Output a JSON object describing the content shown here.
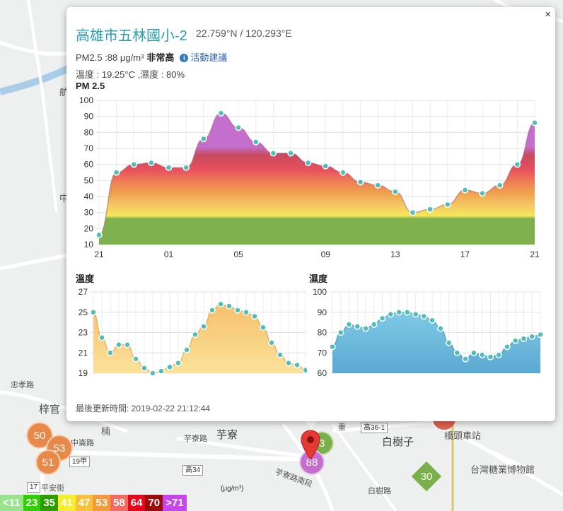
{
  "popup": {
    "station_name": "高雄市五林國小-2",
    "coords": "22.759°N / 120.293°E",
    "pm_line": "PM2.5 :88 μg/m³",
    "pm_level": "非常高",
    "info_icon": "i",
    "advice_link": "活動建議",
    "weather": "溫度 : 19.25°C ,濕度 : 80%",
    "pm_chart_title": "PM 2.5",
    "temp_chart_title": "溫度",
    "hum_chart_title": "濕度",
    "updated": "最後更新時間: 2019-02-22 21:12:44",
    "close": "×"
  },
  "map": {
    "labels": [
      {
        "text": "航",
        "id": "label-hang"
      },
      {
        "text": "中",
        "id": "label-zhong"
      },
      {
        "text": "楠",
        "id": "label-nan"
      },
      {
        "text": "忠孝路",
        "id": "label-zhongxiao"
      },
      {
        "text": "梓官",
        "id": "label-ziguan"
      },
      {
        "text": "中崙路",
        "id": "label-zhonglun"
      },
      {
        "text": "芋寮路",
        "id": "label-yuliaolu"
      },
      {
        "text": "芋寮",
        "id": "label-yuliao"
      },
      {
        "text": "芋寮路南段",
        "id": "label-yuliao-south"
      },
      {
        "text": "白樹子",
        "id": "label-baishuzi"
      },
      {
        "text": "橋頭車站",
        "id": "label-station"
      },
      {
        "text": "台灣糖業博物館",
        "id": "label-museum"
      },
      {
        "text": "平安街",
        "id": "label-pingan"
      },
      {
        "text": "白樹路",
        "id": "label-baishulu"
      },
      {
        "text": "重",
        "id": "label-chong"
      }
    ],
    "road_badges": [
      "高36-1",
      "高34",
      "19甲",
      "17"
    ],
    "markers": [
      {
        "value": "50",
        "color": "#e8894a"
      },
      {
        "value": "53",
        "color": "#e8894a"
      },
      {
        "value": "51",
        "color": "#e8894a"
      },
      {
        "value": "3",
        "color": "#7ab04a"
      },
      {
        "value": "88",
        "color": "#c46fce"
      },
      {
        "value": "30",
        "color": "#7ab04a"
      }
    ]
  },
  "legend": {
    "unit": "(μg/m³)",
    "items": [
      {
        "label": "<11",
        "color": "#9ae28e"
      },
      {
        "label": "23",
        "color": "#31cf00"
      },
      {
        "label": "35",
        "color": "#2c9c00"
      },
      {
        "label": "41",
        "color": "#f6ee2d"
      },
      {
        "label": "47",
        "color": "#f5c23a"
      },
      {
        "label": "53",
        "color": "#f59a37"
      },
      {
        "label": "58",
        "color": "#f26a62"
      },
      {
        "label": "64",
        "color": "#e8061b"
      },
      {
        "label": "70",
        "color": "#9b0b0b"
      },
      {
        "label": ">71",
        "color": "#c745ed"
      }
    ]
  },
  "chart_data": [
    {
      "type": "area",
      "title": "PM 2.5",
      "x_tick_labels": [
        "21",
        "01",
        "05",
        "09",
        "13",
        "17",
        "21"
      ],
      "ylim": [
        10,
        100
      ],
      "y_ticks": [
        10,
        20,
        30,
        40,
        50,
        60,
        70,
        80,
        90,
        100
      ],
      "grid": true,
      "values": [
        16,
        55,
        60,
        61,
        58,
        58,
        76,
        92,
        83,
        74,
        67,
        67,
        61,
        59,
        55,
        49,
        47,
        43,
        30,
        32,
        35,
        44,
        42,
        47,
        60,
        86
      ]
    },
    {
      "type": "area",
      "title": "溫度",
      "ylim": [
        19,
        27
      ],
      "y_ticks": [
        19,
        21,
        23,
        25,
        27
      ],
      "grid": true,
      "color": "#f2c267",
      "values": [
        25,
        22.5,
        21,
        21.8,
        21.8,
        20.4,
        19.5,
        19,
        19.2,
        19.6,
        20,
        21.3,
        22.8,
        23.6,
        25.2,
        25.8,
        25.6,
        25.2,
        25,
        24.6,
        23.5,
        22,
        20.8,
        20,
        19.8,
        19.3
      ]
    },
    {
      "type": "area",
      "title": "濕度",
      "ylim": [
        60,
        100
      ],
      "y_ticks": [
        60,
        70,
        80,
        90,
        100
      ],
      "grid": true,
      "color": "#58b4d8",
      "values": [
        73,
        80,
        84,
        83,
        82,
        84,
        87,
        89,
        90,
        90,
        89,
        88,
        86,
        82,
        75,
        70,
        67,
        70,
        69,
        68,
        69,
        73,
        76,
        77,
        78,
        79
      ]
    }
  ]
}
